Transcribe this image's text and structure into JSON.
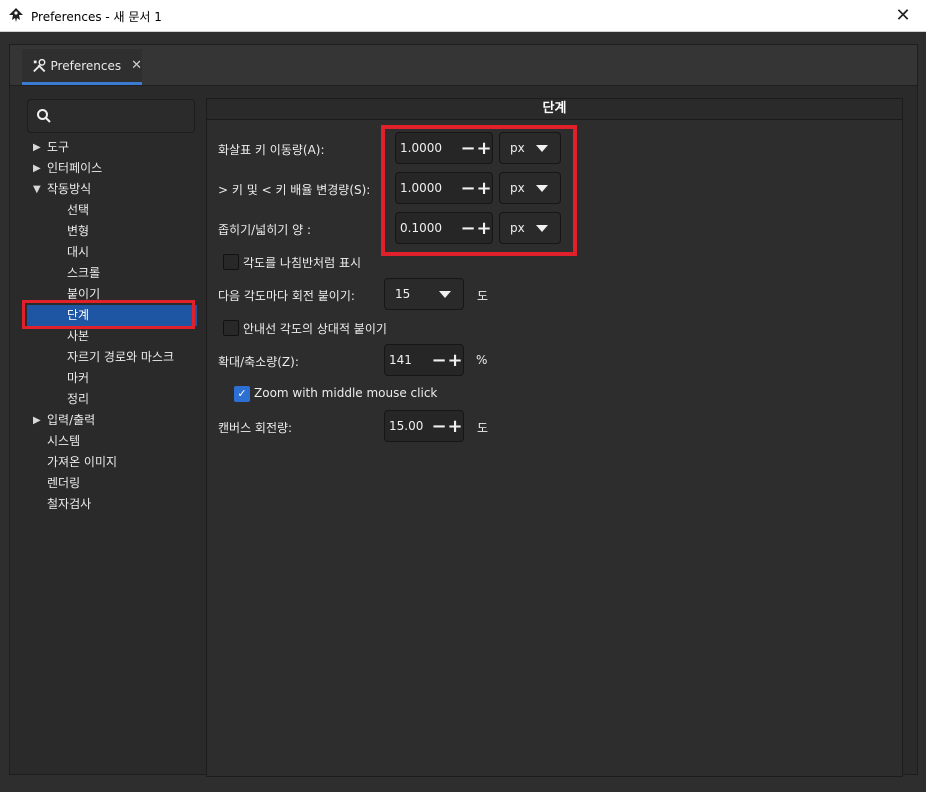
{
  "window": {
    "title": "Preferences - 새 문서 1",
    "close_glyph": "✕"
  },
  "tab": {
    "label": "Preferences",
    "close_glyph": "✕",
    "icon": "wrench-screwdriver-icon"
  },
  "search": {
    "icon": "search-icon",
    "value": ""
  },
  "tree": {
    "items": [
      {
        "label": "도구",
        "expander": "▶"
      },
      {
        "label": "인터페이스",
        "expander": "▶"
      },
      {
        "label": "작동방식",
        "expander": "▼"
      },
      {
        "label": "선택"
      },
      {
        "label": "변형"
      },
      {
        "label": "대시"
      },
      {
        "label": "스크롤"
      },
      {
        "label": "붙이기"
      },
      {
        "label": "단계"
      },
      {
        "label": "사본"
      },
      {
        "label": "자르기 경로와 마스크"
      },
      {
        "label": "마커"
      },
      {
        "label": "정리"
      },
      {
        "label": "입력/출력",
        "expander": "▶"
      },
      {
        "label": "시스템"
      },
      {
        "label": "가져온 이미지"
      },
      {
        "label": "렌더링"
      },
      {
        "label": "철자검사"
      }
    ]
  },
  "panel": {
    "title": "단계",
    "arrow_keys": {
      "label": "화살표 키 이동량(A):",
      "value": "1.0000",
      "unit": "px"
    },
    "scale_keys": {
      "label": "> 키 및 < 키 배율 변경량(S):",
      "value": "1.0000",
      "unit": "px"
    },
    "inset_outset": {
      "label": "좁히기/넓히기 양 :",
      "value": "0.1000",
      "unit": "px"
    },
    "compass_angles": {
      "label": "각도를 나침반처럼 표시",
      "checked": false
    },
    "rotation_snap": {
      "label": "다음 각도마다 회전 붙이기:",
      "value": "15",
      "unit": "도"
    },
    "relative_guides": {
      "label": "안내선 각도의 상대적 붙이기",
      "checked": false
    },
    "zoom_step": {
      "label": "확대/축소량(Z):",
      "value": "141",
      "unit": "%"
    },
    "middle_click_zoom": {
      "label": "Zoom with middle mouse click",
      "checked": true
    },
    "canvas_rotation": {
      "label": "캔버스 회전량:",
      "value": "15.00",
      "unit": "도"
    },
    "minus_glyph": "−",
    "plus_glyph": "+",
    "check_glyph": "✓"
  },
  "colors": {
    "selection": "#1f56a3",
    "highlight_box": "#e0212b",
    "tab_accent": "#3a7ad0"
  }
}
